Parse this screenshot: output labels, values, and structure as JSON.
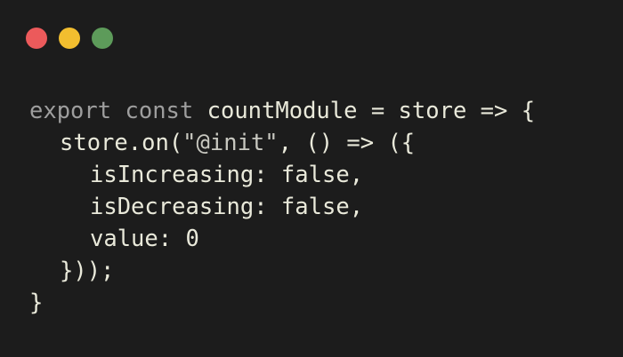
{
  "colors": {
    "background": "#1c1c1c",
    "close": "#ec5a5b",
    "minimize": "#f2be2f",
    "maximize": "#5d9b5a",
    "keyword": "#9e9e9e",
    "text": "#e9e9da",
    "string": "#c8c8c0"
  },
  "window_controls": {
    "close_icon": "red-circle",
    "minimize_icon": "yellow-circle",
    "maximize_icon": "green-circle"
  },
  "code": {
    "line1": {
      "kw_export": "export",
      "kw_const": "const",
      "rest": "countModule = store => {"
    },
    "line2": {
      "before": "store.on(",
      "string": "\"@init\"",
      "after": ", () => ({"
    },
    "line3": "isIncreasing: false,",
    "line4": "isDecreasing: false,",
    "line5": "value: 0",
    "line6": "}));",
    "line7": "}"
  }
}
